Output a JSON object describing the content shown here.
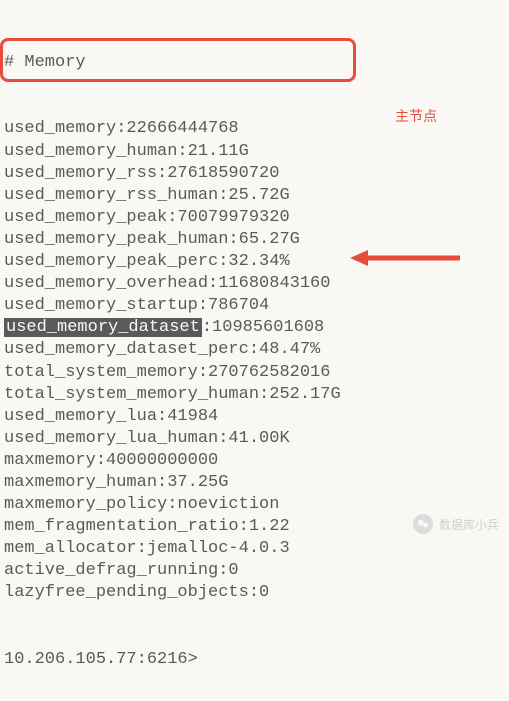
{
  "header": "# Memory",
  "lines": [
    {
      "key": "used_memory",
      "value": "22666444768"
    },
    {
      "key": "used_memory_human",
      "value": "21.11G"
    },
    {
      "key": "used_memory_rss",
      "value": "27618590720"
    },
    {
      "key": "used_memory_rss_human",
      "value": "25.72G"
    },
    {
      "key": "used_memory_peak",
      "value": "70079979320"
    },
    {
      "key": "used_memory_peak_human",
      "value": "65.27G"
    },
    {
      "key": "used_memory_peak_perc",
      "value": "32.34%"
    },
    {
      "key": "used_memory_overhead",
      "value": "11680843160"
    },
    {
      "key": "used_memory_startup",
      "value": "786704"
    },
    {
      "key": "used_memory_dataset",
      "value": "10985601608",
      "highlight_key": true
    },
    {
      "key": "used_memory_dataset_perc",
      "value": "48.47%"
    },
    {
      "key": "total_system_memory",
      "value": "270762582016"
    },
    {
      "key": "total_system_memory_human",
      "value": "252.17G"
    },
    {
      "key": "used_memory_lua",
      "value": "41984"
    },
    {
      "key": "used_memory_lua_human",
      "value": "41.00K"
    },
    {
      "key": "maxmemory",
      "value": "40000000000"
    },
    {
      "key": "maxmemory_human",
      "value": "37.25G"
    },
    {
      "key": "maxmemory_policy",
      "value": "noeviction"
    },
    {
      "key": "mem_fragmentation_ratio",
      "value": "1.22"
    },
    {
      "key": "mem_allocator",
      "value": "jemalloc-4.0.3"
    },
    {
      "key": "active_defrag_running",
      "value": "0"
    },
    {
      "key": "lazyfree_pending_objects",
      "value": "0"
    }
  ],
  "prompt": "10.206.105.77:6216>",
  "annotation_label": "主节点",
  "watermark_text": "数据库小兵"
}
